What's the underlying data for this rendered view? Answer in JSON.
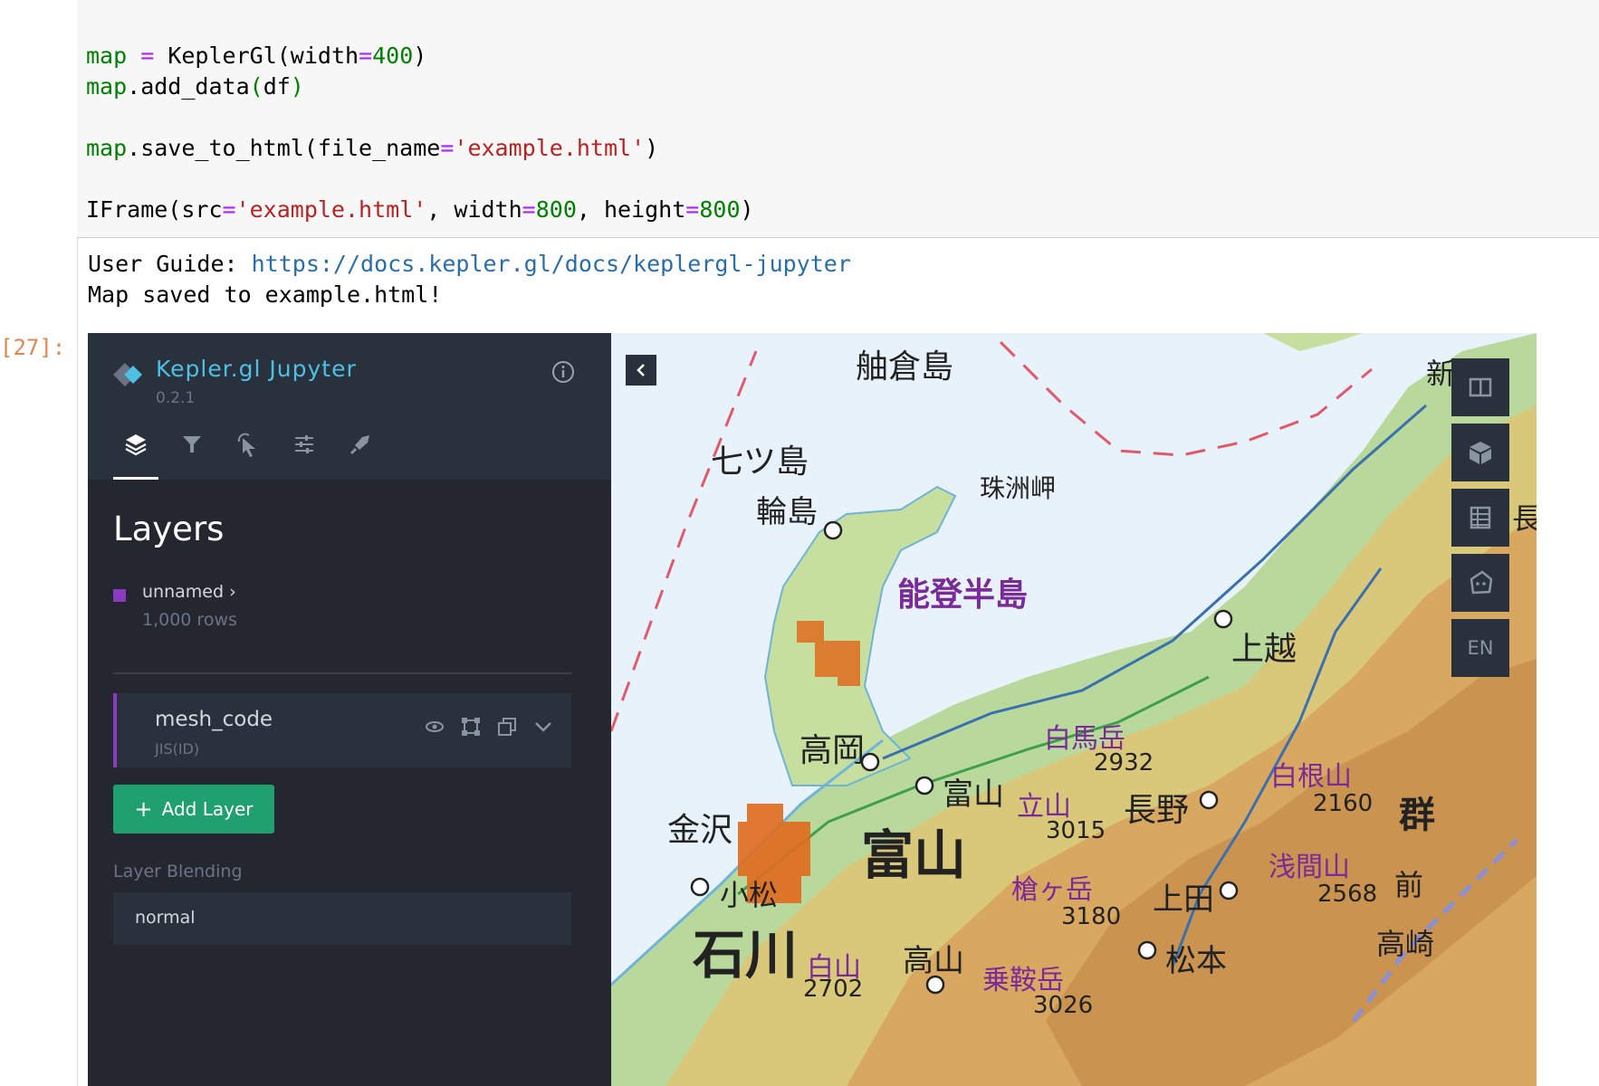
{
  "notebook": {
    "prompt": "[27]:",
    "code_lines": [
      "map = KeplerGl(width=400)",
      "map.add_data(df)",
      "",
      "map.save_to_html(file_name='example.html')",
      "",
      "IFrame(src='example.html', width=800, height=800)"
    ],
    "output": {
      "guide_label": "User Guide: ",
      "guide_url": "https://docs.kepler.gl/docs/keplergl-jupyter",
      "saved_message": "Map saved to example.html!"
    }
  },
  "kepler": {
    "title": "Kepler.gl Jupyter",
    "version": "0.2.1",
    "tabs": [
      "layers-tab",
      "filters-tab",
      "interactions-tab",
      "base-map-tab",
      "export-tab"
    ],
    "active_tab": "layers-tab",
    "section_title": "Layers",
    "dataset": {
      "name": "unnamed",
      "rows": "1,000 rows",
      "color": "#8b3bbf"
    },
    "layer": {
      "name": "mesh_code",
      "type": "JIS(ID)"
    },
    "add_layer_label": "Add Layer",
    "blending_label": "Layer Blending",
    "blending_value": "normal",
    "map_controls": {
      "language": "EN"
    }
  },
  "map_labels": {
    "hekura": "舳倉島",
    "nanatsu": "七ツ島",
    "wajima": "輪島",
    "suzu": "珠洲岬",
    "noto": "能登半島",
    "joetsu": "上越",
    "takaoka": "高岡",
    "hakuba": "白馬岳",
    "hakuba_elev": "2932",
    "toyama_city": "富山",
    "tateyama": "立山",
    "tateyama_elev": "3015",
    "nagano": "長野",
    "shirane": "白根山",
    "shirane_elev": "2160",
    "gun": "群",
    "kanazawa": "金沢",
    "toyama_pref": "富山",
    "yarigatake": "槍ヶ岳",
    "yari_elev": "3180",
    "asama": "浅間山",
    "asama_elev": "2568",
    "komatsu": "小松",
    "ueda": "上田",
    "mae": "前",
    "ishikawa": "石川",
    "hakusan": "白山",
    "hakusan_elev": "2702",
    "takayama": "高山",
    "norikura": "乗鞍岳",
    "norikura_elev": "3026",
    "matsumoto": "松本",
    "takasaki": "高崎",
    "niigata": "新潟",
    "nagaoka": "長"
  }
}
